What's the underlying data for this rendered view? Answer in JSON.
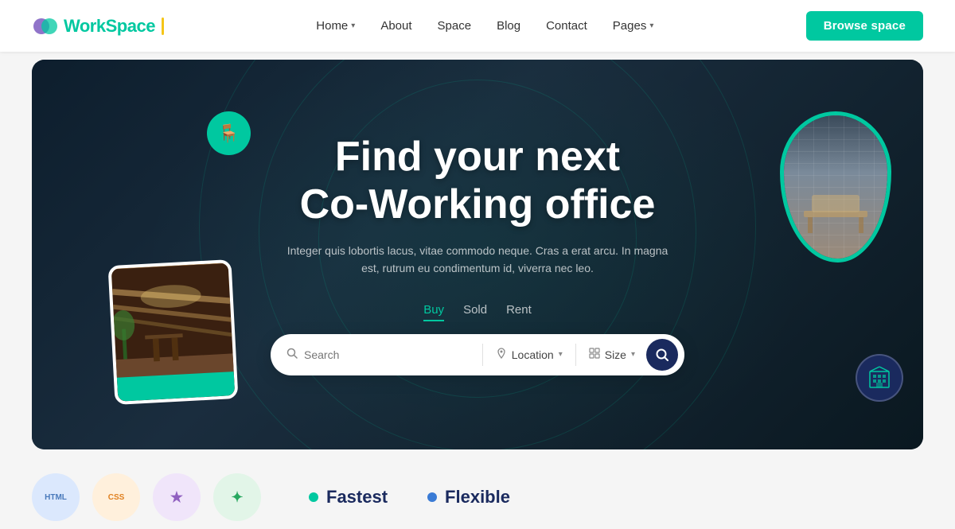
{
  "navbar": {
    "logo": {
      "text_work": "Work",
      "text_space": "Space"
    },
    "nav_items": [
      {
        "label": "Home",
        "has_dropdown": true
      },
      {
        "label": "About",
        "has_dropdown": false
      },
      {
        "label": "Space",
        "has_dropdown": false
      },
      {
        "label": "Blog",
        "has_dropdown": false
      },
      {
        "label": "Contact",
        "has_dropdown": false
      },
      {
        "label": "Pages",
        "has_dropdown": true
      }
    ],
    "cta_label": "Browse space"
  },
  "hero": {
    "title_line1": "Find your next",
    "title_line2": "Co-Working office",
    "subtitle": "Integer quis lobortis lacus, vitae commodo neque. Cras a erat arcu. In magna est, rutrum eu condimentum id, viverra nec leo.",
    "tabs": [
      {
        "label": "Buy",
        "active": true
      },
      {
        "label": "Sold",
        "active": false
      },
      {
        "label": "Rent",
        "active": false
      }
    ],
    "search": {
      "placeholder": "Search",
      "location_label": "Location",
      "size_label": "Size"
    }
  },
  "bottom": {
    "logos": [
      {
        "label": "HTML",
        "bg": "#e8f0fe"
      },
      {
        "label": "CSS",
        "bg": "#fff3e0"
      },
      {
        "label": "★",
        "bg": "#f3e5f5"
      },
      {
        "label": "✦",
        "bg": "#e8f5e9"
      }
    ],
    "features": [
      {
        "label": "Fastest",
        "color": "#00c8a0"
      },
      {
        "label": "Flexible",
        "color": "#3a7bd5"
      }
    ]
  },
  "icons": {
    "search": "🔍",
    "location": "📍",
    "grid": "⊞",
    "chair": "🪑",
    "building": "🏢",
    "search_white": "⌕"
  }
}
